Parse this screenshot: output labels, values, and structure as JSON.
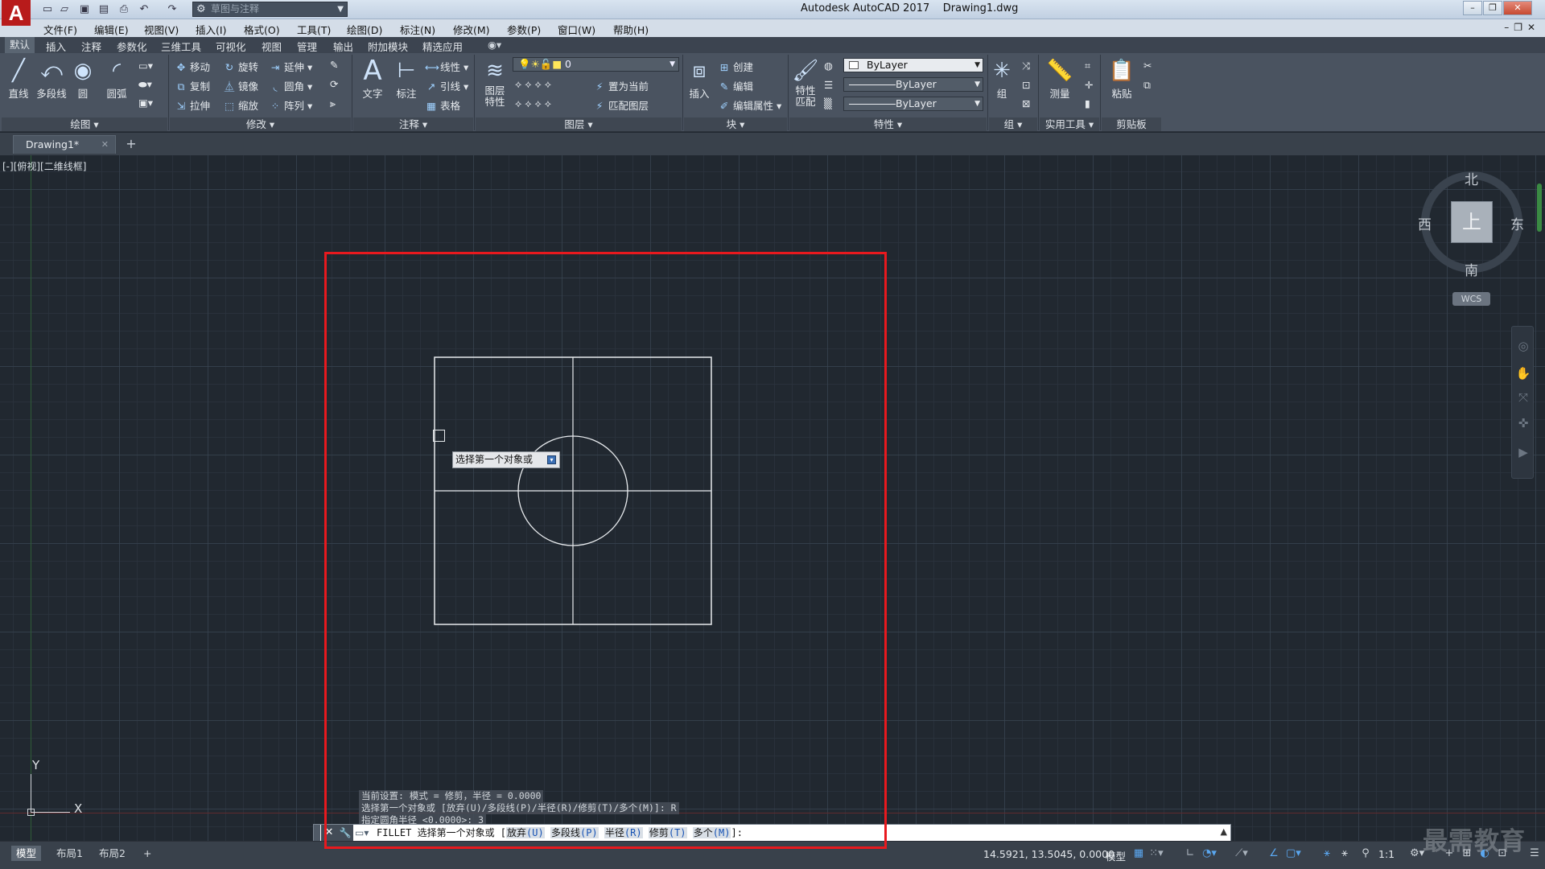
{
  "title_bar": {
    "app_logo": "A",
    "workspace": "草图与注释",
    "app_name": "Autodesk AutoCAD 2017",
    "document": "Drawing1.dwg",
    "quick_access_icons": [
      "new-icon",
      "open-icon",
      "save-icon",
      "saveas-icon",
      "print-icon",
      "undo-icon",
      "redo-icon"
    ]
  },
  "menu": {
    "items": [
      "文件(F)",
      "编辑(E)",
      "视图(V)",
      "插入(I)",
      "格式(O)",
      "工具(T)",
      "绘图(D)",
      "标注(N)",
      "修改(M)",
      "参数(P)",
      "窗口(W)",
      "帮助(H)"
    ]
  },
  "ribbon_tabs": [
    "默认",
    "插入",
    "注释",
    "参数化",
    "三维工具",
    "可视化",
    "视图",
    "管理",
    "输出",
    "附加模块",
    "精选应用"
  ],
  "ribbon": {
    "draw": {
      "title": "绘图",
      "line": "直线",
      "polyline": "多段线",
      "circle": "圆",
      "arc": "圆弧"
    },
    "modify": {
      "title": "修改",
      "move": "移动",
      "rotate": "旋转",
      "extend": "延伸",
      "copy": "复制",
      "mirror": "镜像",
      "fillet": "圆角",
      "stretch": "拉伸",
      "scale": "缩放",
      "array": "阵列"
    },
    "annotation": {
      "title": "注释",
      "text": "文字",
      "dimension": "标注",
      "linear": "线性",
      "leader": "引线",
      "table": "表格"
    },
    "layers": {
      "title": "图层",
      "layer_properties": "图层\n特性",
      "current_layer": "0",
      "set_current": "置为当前",
      "match_layer": "匹配图层"
    },
    "block": {
      "title": "块",
      "insert": "插入",
      "create": "创建",
      "edit": "编辑",
      "edit_attributes": "编辑属性"
    },
    "properties": {
      "title": "特性",
      "match": "特性\n匹配",
      "color": "ByLayer",
      "linetype": "ByLayer",
      "lineweight": "ByLayer"
    },
    "groups": {
      "title": "组",
      "group": "组"
    },
    "utilities": {
      "title": "实用工具",
      "measure": "测量"
    },
    "clipboard": {
      "title": "剪贴板",
      "paste": "粘贴"
    }
  },
  "file_tabs": {
    "active": "Drawing1*"
  },
  "canvas": {
    "viewport_label": "[-][俯视][二维线框]",
    "viewcube": {
      "face": "上",
      "north": "北",
      "south": "南",
      "east": "东",
      "west": "西",
      "wcs": "WCS"
    },
    "tooltip": "选择第一个对象或",
    "ucs": {
      "y": "Y",
      "x": "X"
    }
  },
  "command": {
    "history": [
      "当前设置: 模式 = 修剪，半径 = 0.0000",
      "选择第一个对象或 [放弃(U)/多段线(P)/半径(R)/修剪(T)/多个(M)]: R",
      "指定圆角半径 <0.0000>: 3"
    ],
    "prompt_prefix": "FILLET 选择第一个对象或 [",
    "options": [
      {
        "label": "放弃",
        "key": "(U)"
      },
      {
        "label": "多段线",
        "key": "(P)"
      },
      {
        "label": "半径",
        "key": "(R)"
      },
      {
        "label": "修剪",
        "key": "(T)"
      },
      {
        "label": "多个",
        "key": "(M)"
      }
    ],
    "prompt_suffix": "]:"
  },
  "status": {
    "layout_tabs": [
      "模型",
      "布局1",
      "布局2"
    ],
    "coordinates": "14.5921, 13.5045, 0.0000",
    "model": "模型",
    "scale": "1:1"
  },
  "watermark": "最需教育",
  "colors": {
    "annotation": "#e8191e",
    "canvas": "#212830",
    "logo": "#b81b1b"
  }
}
